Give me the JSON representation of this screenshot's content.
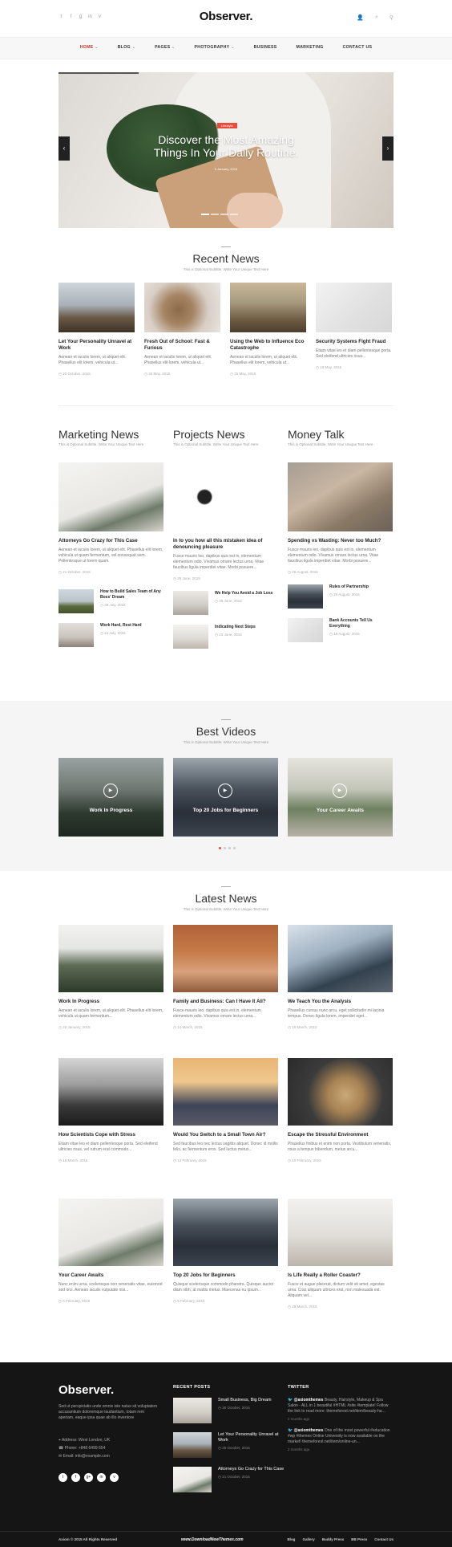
{
  "header": {
    "logo": "Observer.",
    "social_icons": [
      "twitter-icon",
      "facebook-icon",
      "googleplus-icon",
      "linkedin-icon",
      "vine-icon"
    ],
    "utility_icons": [
      "user-icon",
      "search-icon",
      "menu-icon"
    ]
  },
  "nav": {
    "items": [
      {
        "label": "HOME",
        "active": true,
        "caret": true
      },
      {
        "label": "BLOG",
        "caret": true
      },
      {
        "label": "PAGES",
        "caret": true
      },
      {
        "label": "PHOTOGRAPHY",
        "caret": true
      },
      {
        "label": "BUSINESS",
        "caret": false
      },
      {
        "label": "MARKETING",
        "caret": false
      },
      {
        "label": "CONTACT US",
        "caret": false
      }
    ]
  },
  "hero": {
    "tag": "Lifestyle",
    "title_line1": "Discover the Most Amazing",
    "title_line2": "Things In Your Daily Routine.",
    "date": "5 January, 2015"
  },
  "recent": {
    "title": "Recent News",
    "subtitle": "This is Optional Subtitle. Write Your Unique Text Here",
    "posts": [
      {
        "title": "Let Your Personality Unravel at Work",
        "excerpt": "Aenean et iaculis lorem, ut aliquet elit. Phasellus elit lorem, vehicula ut...",
        "date": "20 October, 2015"
      },
      {
        "title": "Fresh Out of School: Fast & Furious",
        "excerpt": "Aenean et iaculis lorem, ut aliquet elit. Phasellus elit lorem, vehicula ut...",
        "date": "30 May, 2015"
      },
      {
        "title": "Using the Web to Influence Eco Catastrophe",
        "excerpt": "Aenean et iaculis lorem, ut aliquet elit. Phasellus elit lorem, vehicula ut...",
        "date": "25 May, 2015"
      },
      {
        "title": "Security Systems Fight Fraud",
        "excerpt": "Etiam vitae leo et diam pellentesque porta. Sed eleifend ultricies risus...",
        "date": "19 May, 2015"
      }
    ]
  },
  "columns": [
    {
      "title": "Marketing News",
      "subtitle": "This is Optional Subtitle. Write Your Unique Text Here",
      "main": {
        "title": "Attorneys Go Crazy for This Case",
        "excerpt": "Aenean et iaculis lorem, ut aliquet elit. Phasellus elit lorem, vehicula ut quam fermentum, vel consequat sem. Pellentesque ut lorem quam.",
        "date": "21 October, 2015"
      },
      "minis": [
        {
          "title": "How to Build Sales Team of Any Boss' Dream",
          "date": "28 July, 2015"
        },
        {
          "title": "Work Hard, Rest Hard",
          "date": "24 July, 2015"
        }
      ]
    },
    {
      "title": "Projects News",
      "subtitle": "This is Optional Subtitle. Write Your Unique Text Here",
      "main": {
        "title": "In to you how all this mistaken idea of denouncing pleasure",
        "excerpt": "Fusce mauris leo, dapibus quis est in, elementum elementum odio. Vivamus ornare lectus urna. Vitae faucibus ligula imperdiet vitae. Morbi posuere...",
        "date": "29 June, 2015"
      },
      "minis": [
        {
          "title": "We Help You Avoid a Job Loss",
          "date": "26 June, 2015"
        },
        {
          "title": "Indicating Next Steps",
          "date": "23 June, 2015"
        }
      ]
    },
    {
      "title": "Money Talk",
      "subtitle": "This is Optional Subtitle. Write Your Unique Text Here",
      "main": {
        "title": "Spending vs Wasting: Never too Much?",
        "excerpt": "Fusce mauris leo, dapibus quis est in, elementum elementum odio. Vivamus ornare lectus urna. Vitae faucibus ligula imperdiet vitae. Morbi posuere...",
        "date": "28 August, 2015"
      },
      "minis": [
        {
          "title": "Rules of Partnership",
          "date": "25 August, 2015"
        },
        {
          "title": "Bank Accounts Tell Us Everything",
          "date": "18 August, 2015"
        }
      ]
    }
  ],
  "videos": {
    "title": "Best Videos",
    "subtitle": "This is Optional Subtitle. Write Your Unique Text Here",
    "items": [
      {
        "title": "Work In Progress"
      },
      {
        "title": "Top 20 Jobs for Beginners"
      },
      {
        "title": "Your Career Awaits"
      }
    ]
  },
  "latest": {
    "title": "Latest News",
    "subtitle": "This is Optional Subtitle. Write Your Unique Text Here",
    "posts": [
      {
        "title": "Work In Progress",
        "excerpt": "Aenean et iaculis lorem, ut aliquet elit. Phasellus elit lorem, vehicula ut quam fermentum...",
        "date": "20 January, 2015"
      },
      {
        "title": "Family and Business: Can I Have It All?",
        "excerpt": "Fusce mauris leo, dapibus quis est in, elementum elementum odio. Vivamus ornare lectus urna...",
        "date": "14 March, 2015"
      },
      {
        "title": "We Teach You the Analysis",
        "excerpt": "Phasellus cursus nunc arcu, eget sollicitudin mi lacinia tempus. Donec ligula lorem, imperdiet eget...",
        "date": "10 March, 2015"
      },
      {
        "title": "How Scientists Cope with Stress",
        "excerpt": "Etiam vitae leo et diam pellentesque porta. Sed eleifend ultricies risus, vel rutrum erat commodo...",
        "date": "16 March, 2015"
      },
      {
        "title": "Would You Switch to a Small Town Air?",
        "excerpt": "Sed faucibus leo nec lectus sagittis aliquet. Donec id mollis felis, ac fermentum eros. Sed luctus metus...",
        "date": "12 February, 2015"
      },
      {
        "title": "Escape the Stressful Environment",
        "excerpt": "Phasellus finibus et enim non porta. Vestibulum venenatis, risus a tempus bibendum, metus arcu...",
        "date": "10 February, 2015"
      },
      {
        "title": "Your Career Awaits",
        "excerpt": "Nunc enim urna, scelerisque non venenatis vitae, euismod sed orci. Aenean iaculis vulputate nisi...",
        "date": "6 February, 2015"
      },
      {
        "title": "Top 20 Jobs for Beginners",
        "excerpt": "Quisque scelerisque commodo pharetra. Quisque auctor diam nibh, at mattis metus. Maecenas eu ipsum...",
        "date": "5 February, 2015"
      },
      {
        "title": "Is Life Really a Roller Coaster?",
        "excerpt": "Fusce et augue placerat, dictum velit sit amet, egestas urna. Cras aliquam ultrices erat, non malesuada est. Aliquam vel...",
        "date": "29 March, 2015"
      }
    ]
  },
  "footer": {
    "logo": "Observer.",
    "about": "Sed ut perspiciatis unde omnis iste natus sit voluptatem accusantium doloremque laudantium, totam rem aperiam, eaque ipsa quae ab illo inventore",
    "address": "Address: West London, UK",
    "phone": "Phone: +848 6499 654",
    "email": "Email: info@example.com",
    "social_icons": [
      "twitter-icon",
      "facebook-icon",
      "googleplus-icon",
      "linkedin-icon",
      "vine-icon"
    ],
    "recent_posts_title": "RECENT POSTS",
    "recent_posts": [
      {
        "title": "Small Business, Big Dream",
        "date": "30 October, 2015"
      },
      {
        "title": "Let Your Personality Unravel at Work",
        "date": "25 October, 2015"
      },
      {
        "title": "Attorneys Go Crazy for This Case",
        "date": "21 October, 2015"
      }
    ],
    "twitter_title": "TWITTER",
    "tweets": [
      {
        "handle": "@axiomthemes",
        "text": "Beauty, Hairstyle, Makeup & Spa Salon - ALL in 1 beautiful #HTML #site #template! Follow the link to read more: themeforest.net/item/beauty-ha...",
        "ago": "2 months ago"
      },
      {
        "handle": "@axiomthemes",
        "text": "One of the most powerful #education #wp #themes Online University is now available on the market! themeforest.net/item/online-un...",
        "ago": "2 months ago"
      }
    ],
    "copyright": "Axiom © 2015 All Rights Reserved",
    "watermark": "www.DownloadNewThemes.com",
    "links": [
      "Blog",
      "Gallery",
      "Buddy Press",
      "BB Press",
      "Contact Us"
    ]
  },
  "colors": {
    "accent": "#e74c3c",
    "footer_bg": "#151515"
  }
}
